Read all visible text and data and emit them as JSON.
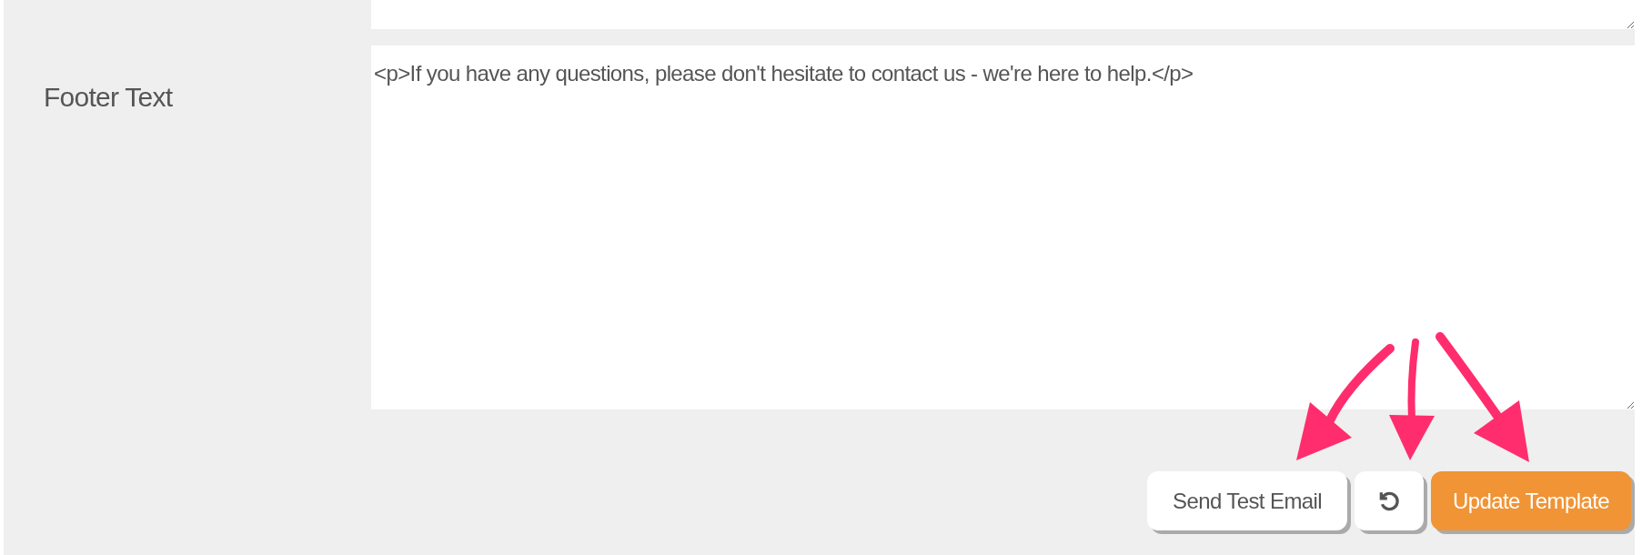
{
  "footer_text": {
    "label": "Footer Text",
    "value": "<p>If you have any questions, please don't hesitate to contact us - we're here to help.</p>"
  },
  "buttons": [
    {
      "kind": "secondary",
      "label": "Send Test Email"
    },
    {
      "kind": "icon"
    },
    {
      "kind": "primary",
      "label": "Update Template"
    }
  ]
}
